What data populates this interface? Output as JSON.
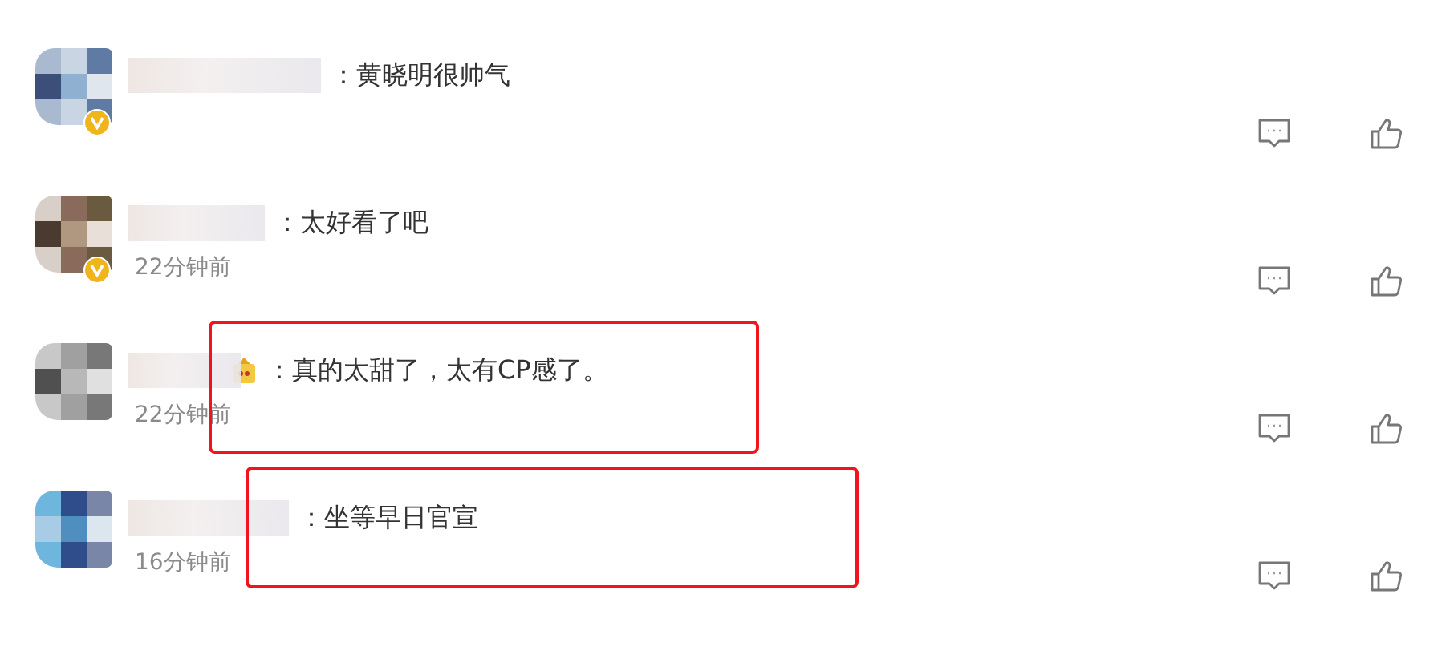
{
  "comments": [
    {
      "text": "：黄晓明很帅气",
      "verified": true,
      "emoji": false,
      "highlighted": false
    },
    {
      "text": "：太好看了吧",
      "time": "22分钟前",
      "verified": true,
      "emoji": false,
      "highlighted": false
    },
    {
      "text": "：真的太甜了，太有CP感了。",
      "time": "22分钟前",
      "verified": false,
      "emoji": true,
      "highlighted": true
    },
    {
      "text": "：坐等早日官宣",
      "time": "16分钟前",
      "verified": false,
      "emoji": false,
      "highlighted": true
    }
  ]
}
